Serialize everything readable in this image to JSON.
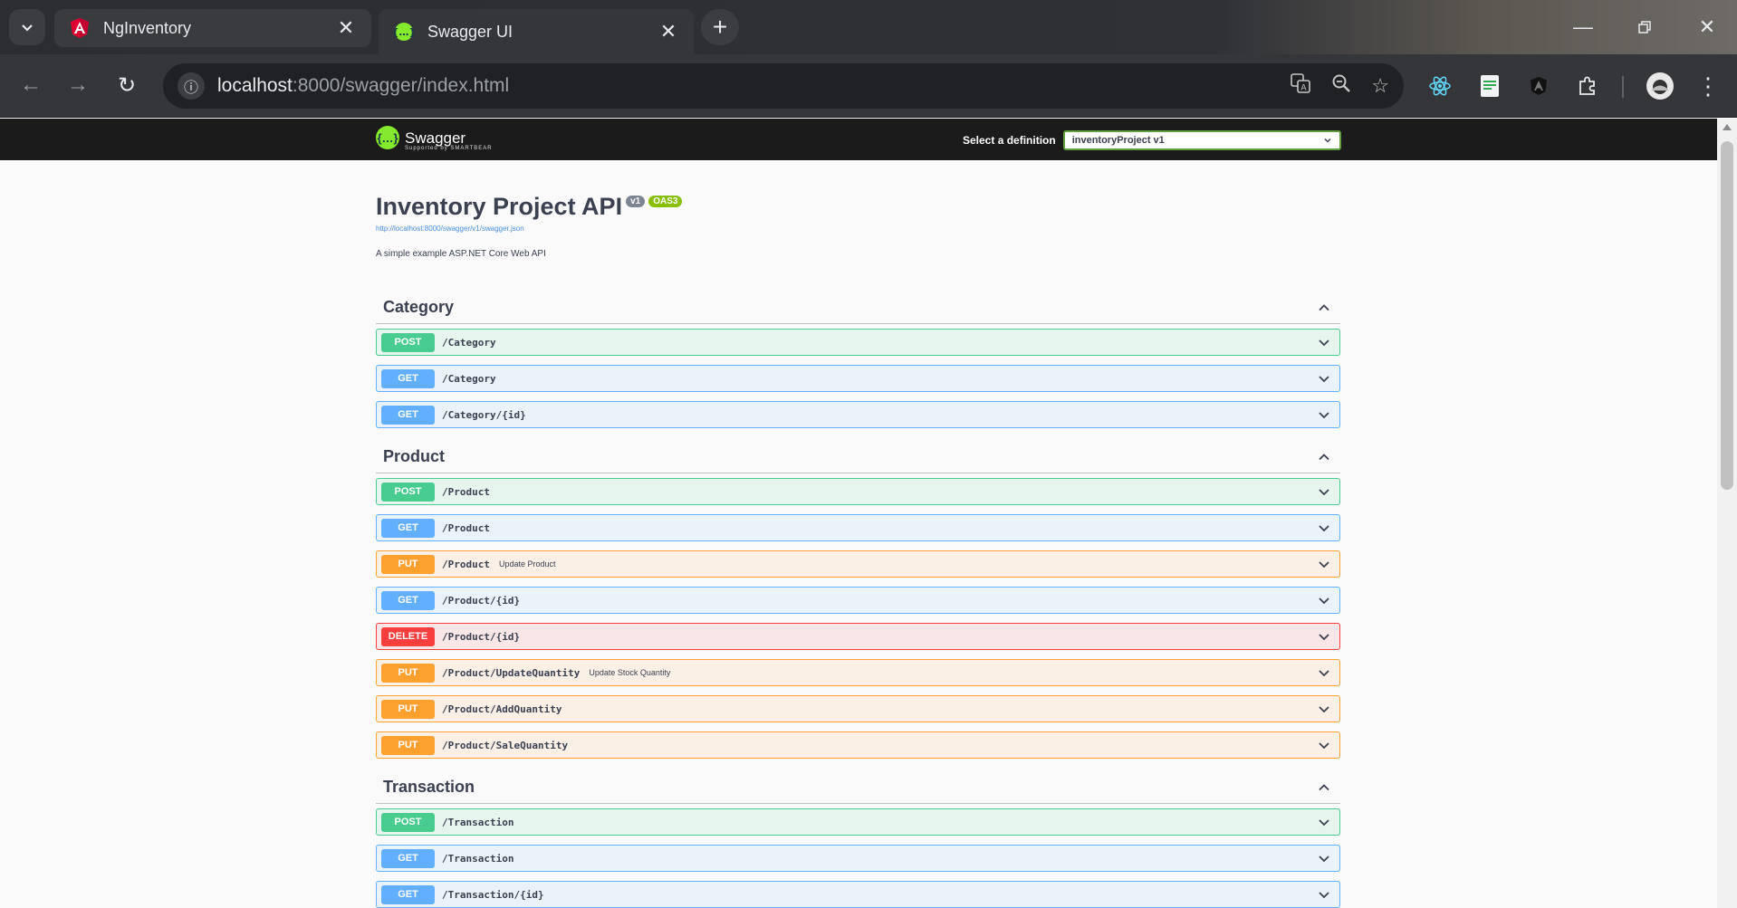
{
  "browser": {
    "tabs": [
      {
        "title": "NgInventory",
        "active": false
      },
      {
        "title": "Swagger UI",
        "active": true
      }
    ],
    "address": {
      "host": "localhost",
      "path": ":8000/swagger/index.html"
    }
  },
  "swagger": {
    "logo_text": "Swagger",
    "logo_sub": "Supported by SMARTBEAR",
    "definition_label": "Select a definition",
    "definition_value": "inventoryProject v1",
    "title": "Inventory Project API",
    "version_badge": "v1",
    "oas_badge": "OAS3",
    "spec_url": "http://localhost:8000/swagger/v1/swagger.json",
    "description": "A simple example ASP.NET Core Web API",
    "sections": [
      {
        "name": "Category",
        "operations": [
          {
            "method": "POST",
            "path": "/Category",
            "summary": ""
          },
          {
            "method": "GET",
            "path": "/Category",
            "summary": ""
          },
          {
            "method": "GET",
            "path": "/Category/{id}",
            "summary": ""
          }
        ]
      },
      {
        "name": "Product",
        "operations": [
          {
            "method": "POST",
            "path": "/Product",
            "summary": ""
          },
          {
            "method": "GET",
            "path": "/Product",
            "summary": ""
          },
          {
            "method": "PUT",
            "path": "/Product",
            "summary": "Update Product"
          },
          {
            "method": "GET",
            "path": "/Product/{id}",
            "summary": ""
          },
          {
            "method": "DELETE",
            "path": "/Product/{id}",
            "summary": ""
          },
          {
            "method": "PUT",
            "path": "/Product/UpdateQuantity",
            "summary": "Update Stock Quantity"
          },
          {
            "method": "PUT",
            "path": "/Product/AddQuantity",
            "summary": ""
          },
          {
            "method": "PUT",
            "path": "/Product/SaleQuantity",
            "summary": ""
          }
        ]
      },
      {
        "name": "Transaction",
        "operations": [
          {
            "method": "POST",
            "path": "/Transaction",
            "summary": ""
          },
          {
            "method": "GET",
            "path": "/Transaction",
            "summary": ""
          },
          {
            "method": "GET",
            "path": "/Transaction/{id}",
            "summary": ""
          }
        ]
      }
    ]
  },
  "colors": {
    "post": "#49cc90",
    "get": "#61affe",
    "put": "#fca130",
    "delete": "#f93e3e"
  }
}
